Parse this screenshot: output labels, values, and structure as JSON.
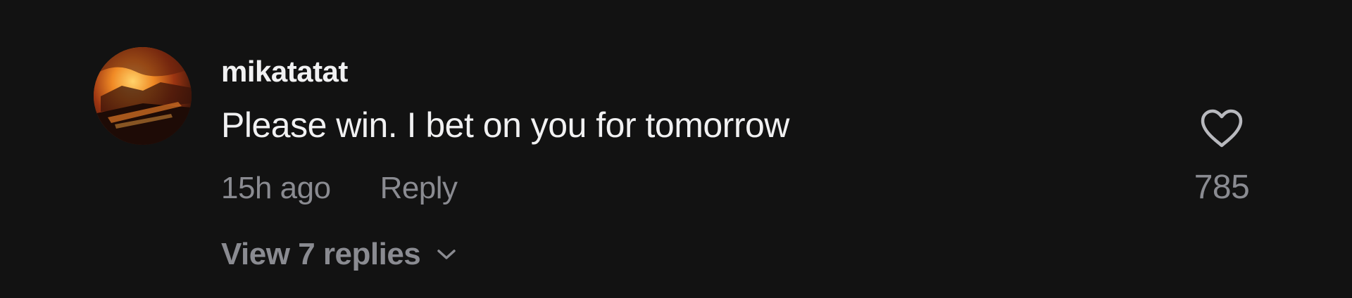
{
  "comment": {
    "username": "mikatatat",
    "text": "Please win. I bet on you for tomorrow",
    "timestamp": "15h ago",
    "reply_label": "Reply",
    "view_replies_label": "View 7 replies",
    "like_count": "785"
  },
  "icons": {
    "like": "heart-outline-icon",
    "expand": "chevron-down-icon"
  },
  "colors": {
    "background": "#121212",
    "primary_text": "#f1f1f2",
    "secondary_text": "#8a8b91"
  }
}
